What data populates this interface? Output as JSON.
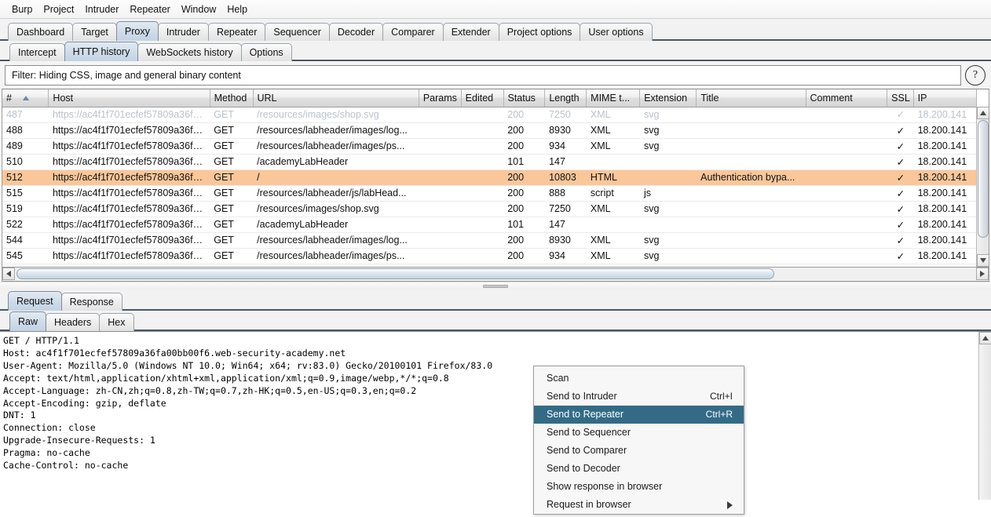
{
  "menubar": {
    "items": [
      {
        "label": "Burp"
      },
      {
        "label": "Project"
      },
      {
        "label": "Intruder"
      },
      {
        "label": "Repeater"
      },
      {
        "label": "Window"
      },
      {
        "label": "Help"
      }
    ]
  },
  "primary_tabs": [
    {
      "label": "Dashboard",
      "selected": false
    },
    {
      "label": "Target",
      "selected": false
    },
    {
      "label": "Proxy",
      "selected": true
    },
    {
      "label": "Intruder",
      "selected": false
    },
    {
      "label": "Repeater",
      "selected": false
    },
    {
      "label": "Sequencer",
      "selected": false
    },
    {
      "label": "Decoder",
      "selected": false
    },
    {
      "label": "Comparer",
      "selected": false
    },
    {
      "label": "Extender",
      "selected": false
    },
    {
      "label": "Project options",
      "selected": false
    },
    {
      "label": "User options",
      "selected": false
    }
  ],
  "secondary_tabs": [
    {
      "label": "Intercept",
      "selected": false
    },
    {
      "label": "HTTP history",
      "selected": true
    },
    {
      "label": "WebSockets history",
      "selected": false
    },
    {
      "label": "Options",
      "selected": false
    }
  ],
  "filter": {
    "text": "Filter: Hiding CSS, image and general binary content",
    "help_icon": "question-mark-icon",
    "help_label": "?"
  },
  "table": {
    "columns": [
      {
        "key": "num",
        "label": "#",
        "sorted": true,
        "sort_dir": "asc"
      },
      {
        "key": "host",
        "label": "Host"
      },
      {
        "key": "method",
        "label": "Method"
      },
      {
        "key": "url",
        "label": "URL"
      },
      {
        "key": "params",
        "label": "Params"
      },
      {
        "key": "edited",
        "label": "Edited"
      },
      {
        "key": "status",
        "label": "Status"
      },
      {
        "key": "length",
        "label": "Length"
      },
      {
        "key": "mime",
        "label": "MIME t..."
      },
      {
        "key": "extension",
        "label": "Extension"
      },
      {
        "key": "title",
        "label": "Title"
      },
      {
        "key": "comment",
        "label": "Comment"
      },
      {
        "key": "ssl",
        "label": "SSL"
      },
      {
        "key": "ip",
        "label": "IP"
      }
    ],
    "rows": [
      {
        "num": "487",
        "host": "https://ac4f1f701ecfef57809a36fa...",
        "method": "GET",
        "url": "/resources/images/shop.svg",
        "params": "",
        "edited": "",
        "status": "200",
        "length": "7250",
        "mime": "XML",
        "extension": "svg",
        "title": "",
        "comment": "",
        "ssl": "✓",
        "ip": "18.200.141",
        "selected": false,
        "clipped": true
      },
      {
        "num": "488",
        "host": "https://ac4f1f701ecfef57809a36fa...",
        "method": "GET",
        "url": "/resources/labheader/images/log...",
        "params": "",
        "edited": "",
        "status": "200",
        "length": "8930",
        "mime": "XML",
        "extension": "svg",
        "title": "",
        "comment": "",
        "ssl": "✓",
        "ip": "18.200.141",
        "selected": false
      },
      {
        "num": "489",
        "host": "https://ac4f1f701ecfef57809a36fa...",
        "method": "GET",
        "url": "/resources/labheader/images/ps...",
        "params": "",
        "edited": "",
        "status": "200",
        "length": "934",
        "mime": "XML",
        "extension": "svg",
        "title": "",
        "comment": "",
        "ssl": "✓",
        "ip": "18.200.141",
        "selected": false
      },
      {
        "num": "510",
        "host": "https://ac4f1f701ecfef57809a36fa...",
        "method": "GET",
        "url": "/academyLabHeader",
        "params": "",
        "edited": "",
        "status": "101",
        "length": "147",
        "mime": "",
        "extension": "",
        "title": "",
        "comment": "",
        "ssl": "✓",
        "ip": "18.200.141",
        "selected": false
      },
      {
        "num": "512",
        "host": "https://ac4f1f701ecfef57809a36fa...",
        "method": "GET",
        "url": "/",
        "params": "",
        "edited": "",
        "status": "200",
        "length": "10803",
        "mime": "HTML",
        "extension": "",
        "title": "Authentication bypa...",
        "comment": "",
        "ssl": "✓",
        "ip": "18.200.141",
        "selected": true
      },
      {
        "num": "515",
        "host": "https://ac4f1f701ecfef57809a36fa...",
        "method": "GET",
        "url": "/resources/labheader/js/labHead...",
        "params": "",
        "edited": "",
        "status": "200",
        "length": "888",
        "mime": "script",
        "extension": "js",
        "title": "",
        "comment": "",
        "ssl": "✓",
        "ip": "18.200.141",
        "selected": false
      },
      {
        "num": "519",
        "host": "https://ac4f1f701ecfef57809a36fa...",
        "method": "GET",
        "url": "/resources/images/shop.svg",
        "params": "",
        "edited": "",
        "status": "200",
        "length": "7250",
        "mime": "XML",
        "extension": "svg",
        "title": "",
        "comment": "",
        "ssl": "✓",
        "ip": "18.200.141",
        "selected": false
      },
      {
        "num": "522",
        "host": "https://ac4f1f701ecfef57809a36fa...",
        "method": "GET",
        "url": "/academyLabHeader",
        "params": "",
        "edited": "",
        "status": "101",
        "length": "147",
        "mime": "",
        "extension": "",
        "title": "",
        "comment": "",
        "ssl": "✓",
        "ip": "18.200.141",
        "selected": false
      },
      {
        "num": "544",
        "host": "https://ac4f1f701ecfef57809a36fa...",
        "method": "GET",
        "url": "/resources/labheader/images/log...",
        "params": "",
        "edited": "",
        "status": "200",
        "length": "8930",
        "mime": "XML",
        "extension": "svg",
        "title": "",
        "comment": "",
        "ssl": "✓",
        "ip": "18.200.141",
        "selected": false
      },
      {
        "num": "545",
        "host": "https://ac4f1f701ecfef57809a36fa...",
        "method": "GET",
        "url": "/resources/labheader/images/ps...",
        "params": "",
        "edited": "",
        "status": "200",
        "length": "934",
        "mime": "XML",
        "extension": "svg",
        "title": "",
        "comment": "",
        "ssl": "✓",
        "ip": "18.200.141",
        "selected": false
      }
    ]
  },
  "message_tabs": [
    {
      "label": "Request",
      "selected": true
    },
    {
      "label": "Response",
      "selected": false
    }
  ],
  "view_tabs": [
    {
      "label": "Raw",
      "selected": true
    },
    {
      "label": "Headers",
      "selected": false
    },
    {
      "label": "Hex",
      "selected": false
    }
  ],
  "request": {
    "raw": "GET / HTTP/1.1\nHost: ac4f1f701ecfef57809a36fa00bb00f6.web-security-academy.net\nUser-Agent: Mozilla/5.0 (Windows NT 10.0; Win64; x64; rv:83.0) Gecko/20100101 Firefox/83.0\nAccept: text/html,application/xhtml+xml,application/xml;q=0.9,image/webp,*/*;q=0.8\nAccept-Language: zh-CN,zh;q=0.8,zh-TW;q=0.7,zh-HK;q=0.5,en-US;q=0.3,en;q=0.2\nAccept-Encoding: gzip, deflate\nDNT: 1\nConnection: close\nUpgrade-Insecure-Requests: 1\nPragma: no-cache\nCache-Control: no-cache"
  },
  "context_menu": {
    "items": [
      {
        "label": "Scan",
        "accel": "",
        "highlight": false,
        "submenu": false
      },
      {
        "label": "Send to Intruder",
        "accel": "Ctrl+I",
        "highlight": false,
        "submenu": false
      },
      {
        "label": "Send to Repeater",
        "accel": "Ctrl+R",
        "highlight": true,
        "submenu": false
      },
      {
        "label": "Send to Sequencer",
        "accel": "",
        "highlight": false,
        "submenu": false
      },
      {
        "label": "Send to Comparer",
        "accel": "",
        "highlight": false,
        "submenu": false
      },
      {
        "label": "Send to Decoder",
        "accel": "",
        "highlight": false,
        "submenu": false
      },
      {
        "label": "Show response in browser",
        "accel": "",
        "highlight": false,
        "submenu": false
      },
      {
        "label": "Request in browser",
        "accel": "",
        "highlight": false,
        "submenu": true
      }
    ]
  },
  "colors": {
    "selected_row": "#fac79a",
    "menu_highlight": "#336b87",
    "tab_selected": "#ccdae8",
    "tabstrip_underline": "#4a5766"
  }
}
